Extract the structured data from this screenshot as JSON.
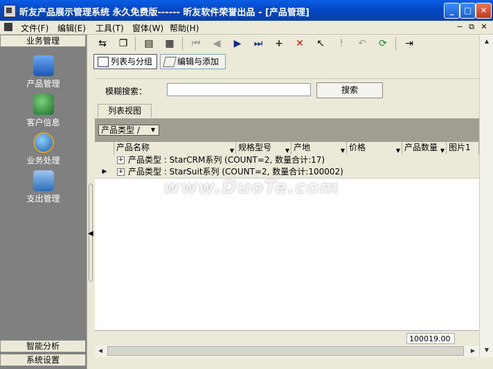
{
  "window": {
    "title": "昕友产品展示管理系统 永久免费版------ 昕友软件荣誉出品 - [产品管理]",
    "min": "_",
    "max": "□",
    "close": "✕"
  },
  "menubar": {
    "items": [
      "文件(F)",
      "编辑(E)",
      "工具(T)",
      "窗体(W)",
      "帮助(H)"
    ],
    "mdi": [
      "−",
      "⧉",
      "✕"
    ]
  },
  "sidebar": {
    "header": "业务管理",
    "items": [
      {
        "label": "产品管理",
        "icon": "product-icon",
        "color": "#2a6fd6"
      },
      {
        "label": "客户信息",
        "icon": "customer-icon",
        "color": "#2f9e44"
      },
      {
        "label": "业务处理",
        "icon": "globe-icon",
        "color": "#1f7ac0"
      },
      {
        "label": "支出管理",
        "icon": "expense-icon",
        "color": "#3b82c4"
      }
    ],
    "bottom": [
      "智能分析",
      "系统设置"
    ]
  },
  "tabs": {
    "list_group": "列表与分组",
    "edit_add": "编辑与添加"
  },
  "search": {
    "label": "模糊搜索：",
    "value": "",
    "button": "搜索"
  },
  "view_tab": "列表视图",
  "group_panel": {
    "chip": "产品类型",
    "sort": "/"
  },
  "grid": {
    "columns": [
      "产品名称",
      "规格型号",
      "产地",
      "价格",
      "产品数量",
      "图片1"
    ],
    "rows": [
      "产品类型 : StarCRM系列 (COUNT=2, 数量合计:17)",
      "产品类型 : StarSuit系列 (COUNT=2, 数量合计:100002)"
    ],
    "footer_total": "100019.00"
  },
  "watermark": "www.DuoTe.com"
}
